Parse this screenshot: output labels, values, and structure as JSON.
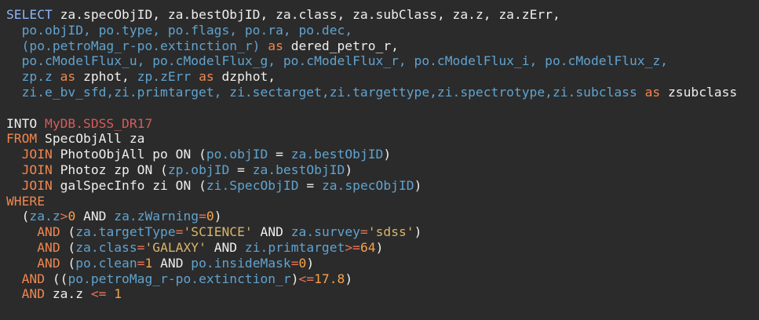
{
  "colors": {
    "background": "#2b2b2b",
    "text": "#eeeeec",
    "keyword": "#8ab4f8",
    "identifier": "#5fa3cf",
    "alias_keyword": "#f0874f",
    "operator": "#e8735a",
    "number": "#f5a24b",
    "string": "#d8b56a",
    "table_name": "#d45c5c"
  },
  "lines": [
    [
      {
        "t": "SELECT",
        "c": "keyword"
      },
      {
        "t": " za.specObjID, za.bestObjID, za.",
        "c": "text"
      },
      {
        "t": "class",
        "c": "text"
      },
      {
        "t": ", za.subClass, za.z, za.zErr,",
        "c": "text"
      }
    ],
    [
      {
        "t": "  po.objID, po.type, po.flags, po.ra, po.dec,",
        "c": "identifier"
      }
    ],
    [
      {
        "t": "  (po.petroMag_r-po.extinction_r) ",
        "c": "identifier"
      },
      {
        "t": "as",
        "c": "alias_keyword"
      },
      {
        "t": " dered_petro_r,",
        "c": "text"
      }
    ],
    [
      {
        "t": "  po.cModelFlux_u, po.cModelFlux_g, po.cModelFlux_r, po.cModelFlux_i, po.cModelFlux_z,",
        "c": "identifier"
      }
    ],
    [
      {
        "t": "  zp.z ",
        "c": "identifier"
      },
      {
        "t": "as",
        "c": "alias_keyword"
      },
      {
        "t": " zphot, ",
        "c": "text"
      },
      {
        "t": "zp.zErr ",
        "c": "identifier"
      },
      {
        "t": "as",
        "c": "alias_keyword"
      },
      {
        "t": " dzphot,",
        "c": "text"
      }
    ],
    [
      {
        "t": "  zi.e_bv_sfd,zi.primtarget, zi.sectarget,zi.targettype,zi.spectrotype,zi.subclass ",
        "c": "identifier"
      },
      {
        "t": "as",
        "c": "alias_keyword"
      },
      {
        "t": " zsubclass",
        "c": "text"
      }
    ],
    [],
    [
      {
        "t": "INTO ",
        "c": "text"
      },
      {
        "t": "MyDB.SDSS_DR17",
        "c": "table_name"
      }
    ],
    [
      {
        "t": "FROM",
        "c": "alias_keyword"
      },
      {
        "t": " SpecObjAll za",
        "c": "text"
      }
    ],
    [
      {
        "t": "  JOIN",
        "c": "alias_keyword"
      },
      {
        "t": " PhotoObjAll po ON (",
        "c": "text"
      },
      {
        "t": "po.objID",
        "c": "identifier"
      },
      {
        "t": " = ",
        "c": "text"
      },
      {
        "t": "za.bestObjID",
        "c": "identifier"
      },
      {
        "t": ")",
        "c": "text"
      }
    ],
    [
      {
        "t": "  JOIN",
        "c": "alias_keyword"
      },
      {
        "t": " Photoz zp ON (",
        "c": "text"
      },
      {
        "t": "zp.objID",
        "c": "identifier"
      },
      {
        "t": " = ",
        "c": "text"
      },
      {
        "t": "za.bestObjID",
        "c": "identifier"
      },
      {
        "t": ")",
        "c": "text"
      }
    ],
    [
      {
        "t": "  JOIN",
        "c": "alias_keyword"
      },
      {
        "t": " galSpecInfo zi ON (",
        "c": "text"
      },
      {
        "t": "zi.SpecObjID",
        "c": "identifier"
      },
      {
        "t": " = ",
        "c": "text"
      },
      {
        "t": "za.specObjID",
        "c": "identifier"
      },
      {
        "t": ")",
        "c": "text"
      }
    ],
    [
      {
        "t": "WHERE",
        "c": "alias_keyword"
      }
    ],
    [
      {
        "t": "  (",
        "c": "text"
      },
      {
        "t": "za.z",
        "c": "identifier"
      },
      {
        "t": ">",
        "c": "operator"
      },
      {
        "t": "0",
        "c": "number"
      },
      {
        "t": " AND ",
        "c": "text"
      },
      {
        "t": "za.zWarning",
        "c": "identifier"
      },
      {
        "t": "=",
        "c": "operator"
      },
      {
        "t": "0",
        "c": "number"
      },
      {
        "t": ")",
        "c": "text"
      }
    ],
    [
      {
        "t": "    AND",
        "c": "alias_keyword"
      },
      {
        "t": " (",
        "c": "text"
      },
      {
        "t": "za.targetType",
        "c": "identifier"
      },
      {
        "t": "=",
        "c": "operator"
      },
      {
        "t": "'SCIENCE'",
        "c": "string"
      },
      {
        "t": " AND ",
        "c": "text"
      },
      {
        "t": "za.survey",
        "c": "identifier"
      },
      {
        "t": "=",
        "c": "operator"
      },
      {
        "t": "'sdss'",
        "c": "string"
      },
      {
        "t": ")",
        "c": "text"
      }
    ],
    [
      {
        "t": "    AND",
        "c": "alias_keyword"
      },
      {
        "t": " (",
        "c": "text"
      },
      {
        "t": "za.class",
        "c": "identifier"
      },
      {
        "t": "=",
        "c": "operator"
      },
      {
        "t": "'GALAXY'",
        "c": "string"
      },
      {
        "t": " AND ",
        "c": "text"
      },
      {
        "t": "zi.primtarget",
        "c": "identifier"
      },
      {
        "t": ">=",
        "c": "operator"
      },
      {
        "t": "64",
        "c": "number"
      },
      {
        "t": ")",
        "c": "text"
      }
    ],
    [
      {
        "t": "    AND",
        "c": "alias_keyword"
      },
      {
        "t": " (",
        "c": "text"
      },
      {
        "t": "po.clean",
        "c": "identifier"
      },
      {
        "t": "=",
        "c": "operator"
      },
      {
        "t": "1",
        "c": "number"
      },
      {
        "t": " AND ",
        "c": "text"
      },
      {
        "t": "po.insideMask",
        "c": "identifier"
      },
      {
        "t": "=",
        "c": "operator"
      },
      {
        "t": "0",
        "c": "number"
      },
      {
        "t": ")",
        "c": "text"
      }
    ],
    [
      {
        "t": "  AND",
        "c": "alias_keyword"
      },
      {
        "t": " ((",
        "c": "text"
      },
      {
        "t": "po.petroMag_r-po.extinction_r",
        "c": "identifier"
      },
      {
        "t": ")",
        "c": "text"
      },
      {
        "t": "<=",
        "c": "operator"
      },
      {
        "t": "17.8",
        "c": "number"
      },
      {
        "t": ")",
        "c": "text"
      }
    ],
    [
      {
        "t": "  AND",
        "c": "alias_keyword"
      },
      {
        "t": " za.z ",
        "c": "text"
      },
      {
        "t": "<=",
        "c": "operator"
      },
      {
        "t": " ",
        "c": "text"
      },
      {
        "t": "1",
        "c": "number"
      }
    ]
  ]
}
